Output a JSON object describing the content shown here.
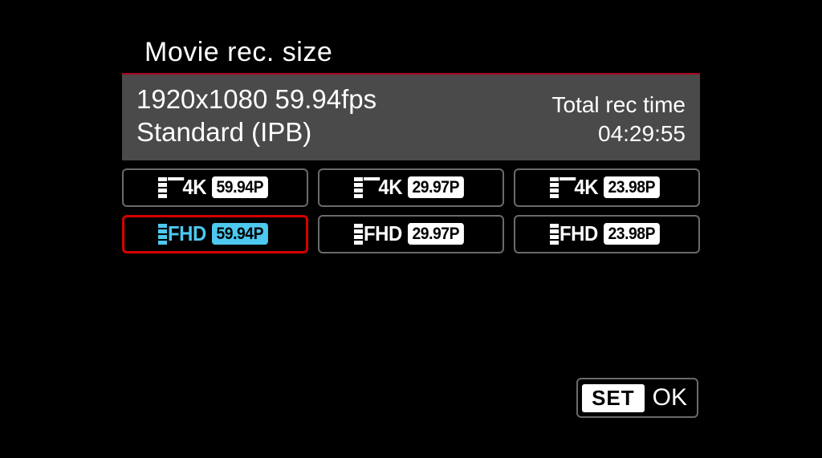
{
  "title": "Movie rec. size",
  "info": {
    "resolution_fps": "1920x1080 59.94fps",
    "compression": "Standard (IPB)",
    "rec_time_label": "Total rec time",
    "rec_time_value": "04:29:55"
  },
  "options": [
    {
      "res": "4K",
      "fps": "59.94P",
      "selected": false
    },
    {
      "res": "4K",
      "fps": "29.97P",
      "selected": false
    },
    {
      "res": "4K",
      "fps": "23.98P",
      "selected": false
    },
    {
      "res": "FHD",
      "fps": "59.94P",
      "selected": true
    },
    {
      "res": "FHD",
      "fps": "29.97P",
      "selected": false
    },
    {
      "res": "FHD",
      "fps": "23.98P",
      "selected": false
    }
  ],
  "footer": {
    "set_label": "SET",
    "ok_label": "OK"
  }
}
